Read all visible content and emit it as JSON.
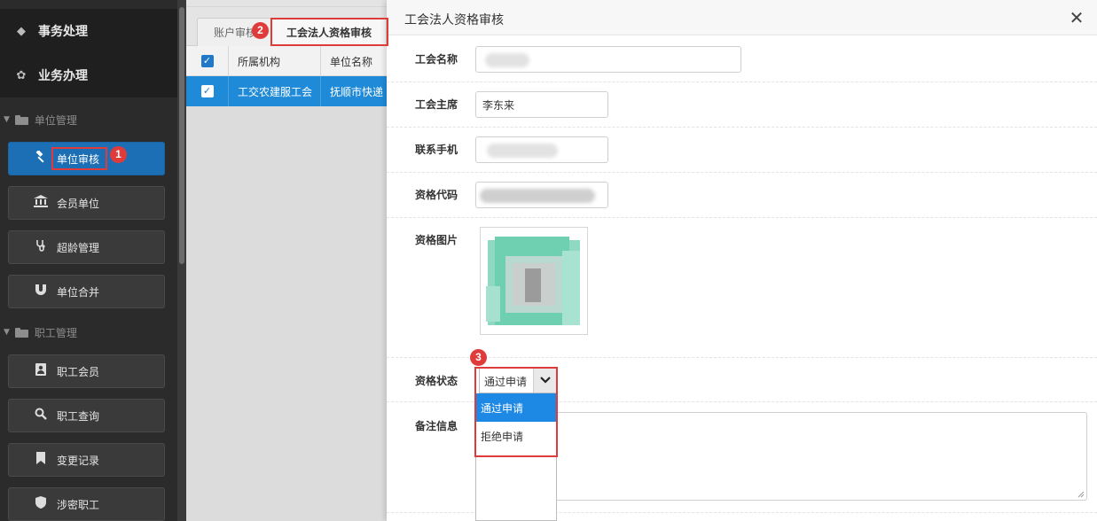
{
  "sidebar": {
    "top_items": [
      {
        "label": "事务处理",
        "icon": "tag-icon"
      },
      {
        "label": "业务办理",
        "icon": "leaf-icon"
      }
    ],
    "groups": [
      {
        "label": "单位管理",
        "items": [
          {
            "label": "单位审核",
            "icon": "gavel-icon",
            "active": true
          },
          {
            "label": "会员单位",
            "icon": "bank-icon"
          },
          {
            "label": "超龄管理",
            "icon": "stethoscope-icon"
          },
          {
            "label": "单位合并",
            "icon": "magnet-icon"
          }
        ]
      },
      {
        "label": "职工管理",
        "items": [
          {
            "label": "职工会员",
            "icon": "user-card-icon"
          },
          {
            "label": "职工查询",
            "icon": "search-icon"
          },
          {
            "label": "变更记录",
            "icon": "bookmark-icon"
          },
          {
            "label": "涉密职工",
            "icon": "shield-icon"
          }
        ]
      }
    ]
  },
  "main": {
    "tabs": [
      {
        "label": "账户审核",
        "active": false
      },
      {
        "label": "工会法人资格审核",
        "active": true
      }
    ],
    "grid": {
      "columns": [
        "所属机构",
        "单位名称"
      ],
      "rows": [
        {
          "checked": true,
          "cells": [
            "工交农建服工会",
            "抚顺市快递"
          ]
        }
      ]
    }
  },
  "dialog": {
    "title": "工会法人资格审核",
    "fields": {
      "union_name": {
        "label": "工会名称",
        "value": ""
      },
      "chairman": {
        "label": "工会主席",
        "value": "李东来"
      },
      "phone": {
        "label": "联系手机",
        "value": ""
      },
      "code": {
        "label": "资格代码",
        "value": ""
      },
      "image": {
        "label": "资格图片"
      },
      "status": {
        "label": "资格状态",
        "value": "通过申请",
        "options": [
          "通过申请",
          "拒绝申请"
        ],
        "selected_index": 0
      },
      "remark": {
        "label": "备注信息",
        "value": ""
      }
    }
  },
  "annotations": [
    "1",
    "2",
    "3"
  ],
  "colors": {
    "active_blue": "#1d6fb5",
    "highlight_red": "#e03b3b",
    "row_blue": "#1f8ad8"
  }
}
